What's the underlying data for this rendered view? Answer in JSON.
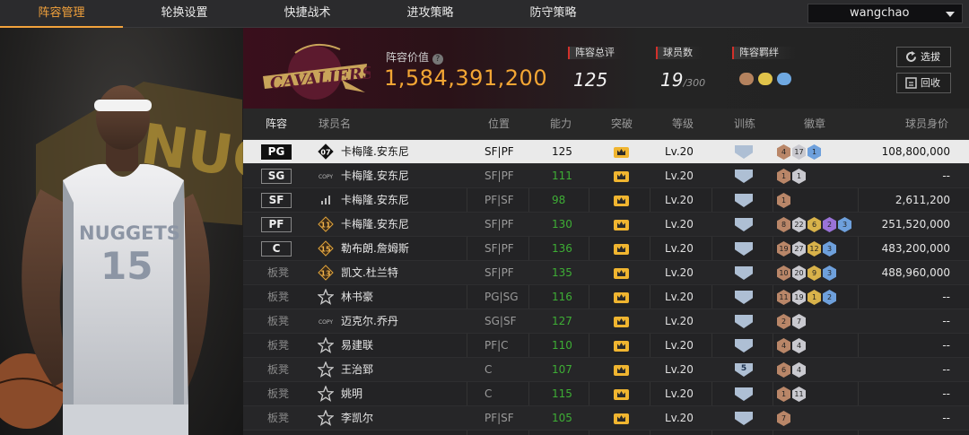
{
  "nav": {
    "tabs": [
      {
        "label": "阵容管理",
        "active": true
      },
      {
        "label": "轮换设置",
        "active": false
      },
      {
        "label": "快捷战术",
        "active": false
      },
      {
        "label": "进攻策略",
        "active": false
      },
      {
        "label": "防守策略",
        "active": false
      }
    ],
    "user": "wangchao"
  },
  "header": {
    "team_logo": "cleveland-cavaliers-logo",
    "value_label": "阵容价值",
    "value": "1,584,391,200",
    "rating_label": "阵容总评",
    "rating": "125",
    "count_label": "球员数",
    "count": "19",
    "count_max": "/300",
    "bond_label": "阵容羁绊",
    "btn_select": "选拔",
    "btn_recycle": "回收"
  },
  "table": {
    "columns": {
      "lineup": "阵容",
      "name": "球员名",
      "position": "位置",
      "ability": "能力",
      "breakthrough": "突破",
      "level": "等级",
      "training": "训练",
      "badges": "徽章",
      "value": "球员身价"
    },
    "rows": [
      {
        "slot": "PG",
        "starter": true,
        "jersey": "07",
        "name": "卡梅隆.安东尼",
        "pos": "SF|PF",
        "ability": "125",
        "level": "Lv.20",
        "train": "",
        "badges": [
          [
            "br",
            "4"
          ],
          [
            "si",
            "17"
          ],
          [
            "bl",
            "1"
          ]
        ],
        "value": "108,800,000"
      },
      {
        "slot": "SG",
        "starter": true,
        "jersey": "COPY",
        "name": "卡梅隆.安东尼",
        "pos": "SF|PF",
        "ability": "111",
        "level": "Lv.20",
        "train": "",
        "badges": [
          [
            "br",
            "1"
          ],
          [
            "si",
            "1"
          ]
        ],
        "value": "--"
      },
      {
        "slot": "SF",
        "starter": true,
        "jersey": "bars",
        "name": "卡梅隆.安东尼",
        "pos": "PF|SF",
        "ability": "98",
        "level": "Lv.20",
        "train": "",
        "badges": [
          [
            "br",
            "1"
          ]
        ],
        "value": "2,611,200"
      },
      {
        "slot": "PF",
        "starter": true,
        "jersey": "11",
        "name": "卡梅隆.安东尼",
        "pos": "SF|PF",
        "ability": "130",
        "level": "Lv.20",
        "train": "",
        "badges": [
          [
            "br",
            "8"
          ],
          [
            "si",
            "22"
          ],
          [
            "go",
            "6"
          ],
          [
            "pu",
            "2"
          ],
          [
            "bl",
            "3"
          ]
        ],
        "value": "251,520,000"
      },
      {
        "slot": "C",
        "starter": true,
        "jersey": "15",
        "name": "勒布朗.詹姆斯",
        "pos": "SF|PF",
        "ability": "136",
        "level": "Lv.20",
        "train": "",
        "badges": [
          [
            "br",
            "19"
          ],
          [
            "si",
            "27"
          ],
          [
            "go",
            "12"
          ],
          [
            "bl",
            "3"
          ]
        ],
        "value": "483,200,000"
      },
      {
        "slot": "板凳",
        "starter": false,
        "jersey": "13",
        "name": "凯文.杜兰特",
        "pos": "SF|PF",
        "ability": "135",
        "level": "Lv.20",
        "train": "",
        "badges": [
          [
            "br",
            "10"
          ],
          [
            "si",
            "20"
          ],
          [
            "go",
            "9"
          ],
          [
            "bl",
            "3"
          ]
        ],
        "value": "488,960,000"
      },
      {
        "slot": "板凳",
        "starter": false,
        "jersey": "star",
        "name": "林书豪",
        "pos": "PG|SG",
        "ability": "116",
        "level": "Lv.20",
        "train": "",
        "badges": [
          [
            "br",
            "11"
          ],
          [
            "si",
            "19"
          ],
          [
            "go",
            "1"
          ],
          [
            "bl",
            "2"
          ]
        ],
        "value": "--"
      },
      {
        "slot": "板凳",
        "starter": false,
        "jersey": "COPY",
        "name": "迈克尔.乔丹",
        "pos": "SG|SF",
        "ability": "127",
        "level": "Lv.20",
        "train": "",
        "badges": [
          [
            "br",
            "2"
          ],
          [
            "si",
            "7"
          ]
        ],
        "value": "--"
      },
      {
        "slot": "板凳",
        "starter": false,
        "jersey": "star",
        "name": "易建联",
        "pos": "PF|C",
        "ability": "110",
        "level": "Lv.20",
        "train": "",
        "badges": [
          [
            "br",
            "4"
          ],
          [
            "si",
            "4"
          ]
        ],
        "value": "--"
      },
      {
        "slot": "板凳",
        "starter": false,
        "jersey": "star",
        "name": "王治郅",
        "pos": "C",
        "ability": "107",
        "level": "Lv.20",
        "train": "5",
        "badges": [
          [
            "br",
            "6"
          ],
          [
            "si",
            "4"
          ]
        ],
        "value": "--"
      },
      {
        "slot": "板凳",
        "starter": false,
        "jersey": "star",
        "name": "姚明",
        "pos": "C",
        "ability": "115",
        "level": "Lv.20",
        "train": "",
        "badges": [
          [
            "br",
            "1"
          ],
          [
            "si",
            "11"
          ]
        ],
        "value": "--"
      },
      {
        "slot": "板凳",
        "starter": false,
        "jersey": "star",
        "name": "李凯尔",
        "pos": "PF|SF",
        "ability": "105",
        "level": "Lv.20",
        "train": "",
        "badges": [
          [
            "br",
            "7"
          ]
        ],
        "value": "--"
      }
    ]
  }
}
